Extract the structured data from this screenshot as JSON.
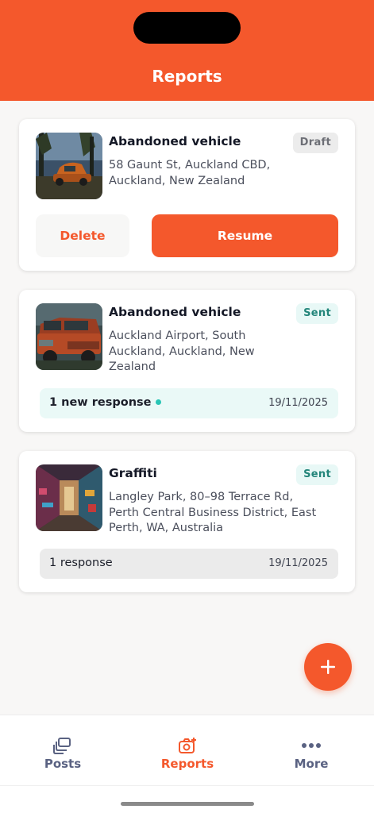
{
  "header": {
    "title": "Reports"
  },
  "reports": [
    {
      "title": "Abandoned vehicle",
      "address": "58 Gaunt St, Auckland CBD, Auckland, New Zealand",
      "status": "Draft",
      "actions": {
        "delete": "Delete",
        "resume": "Resume"
      }
    },
    {
      "title": "Abandoned vehicle",
      "address": "Auckland Airport, South Auckland, Auckland, New Zealand",
      "status": "Sent",
      "response_text": "1 new response",
      "response_date": "19/11/2025"
    },
    {
      "title": "Graffiti",
      "address": "Langley Park, 80–98 Terrace Rd, Perth Central Business District, East Perth, WA, Australia",
      "status": "Sent",
      "response_text": "1 response",
      "response_date": "19/11/2025"
    }
  ],
  "fab": {
    "icon": "plus-icon"
  },
  "tabbar": {
    "tabs": [
      {
        "label": "Posts",
        "icon": "posts-icon"
      },
      {
        "label": "Reports",
        "icon": "camera-report-icon"
      },
      {
        "label": "More",
        "icon": "more-dots-icon"
      }
    ],
    "active": "Reports"
  },
  "colors": {
    "accent": "#f4582c",
    "sent_badge_bg": "#e8f8f6",
    "sent_badge_text": "#23857a",
    "draft_badge_bg": "#ececec",
    "new_response_dot": "#28c5b5"
  }
}
